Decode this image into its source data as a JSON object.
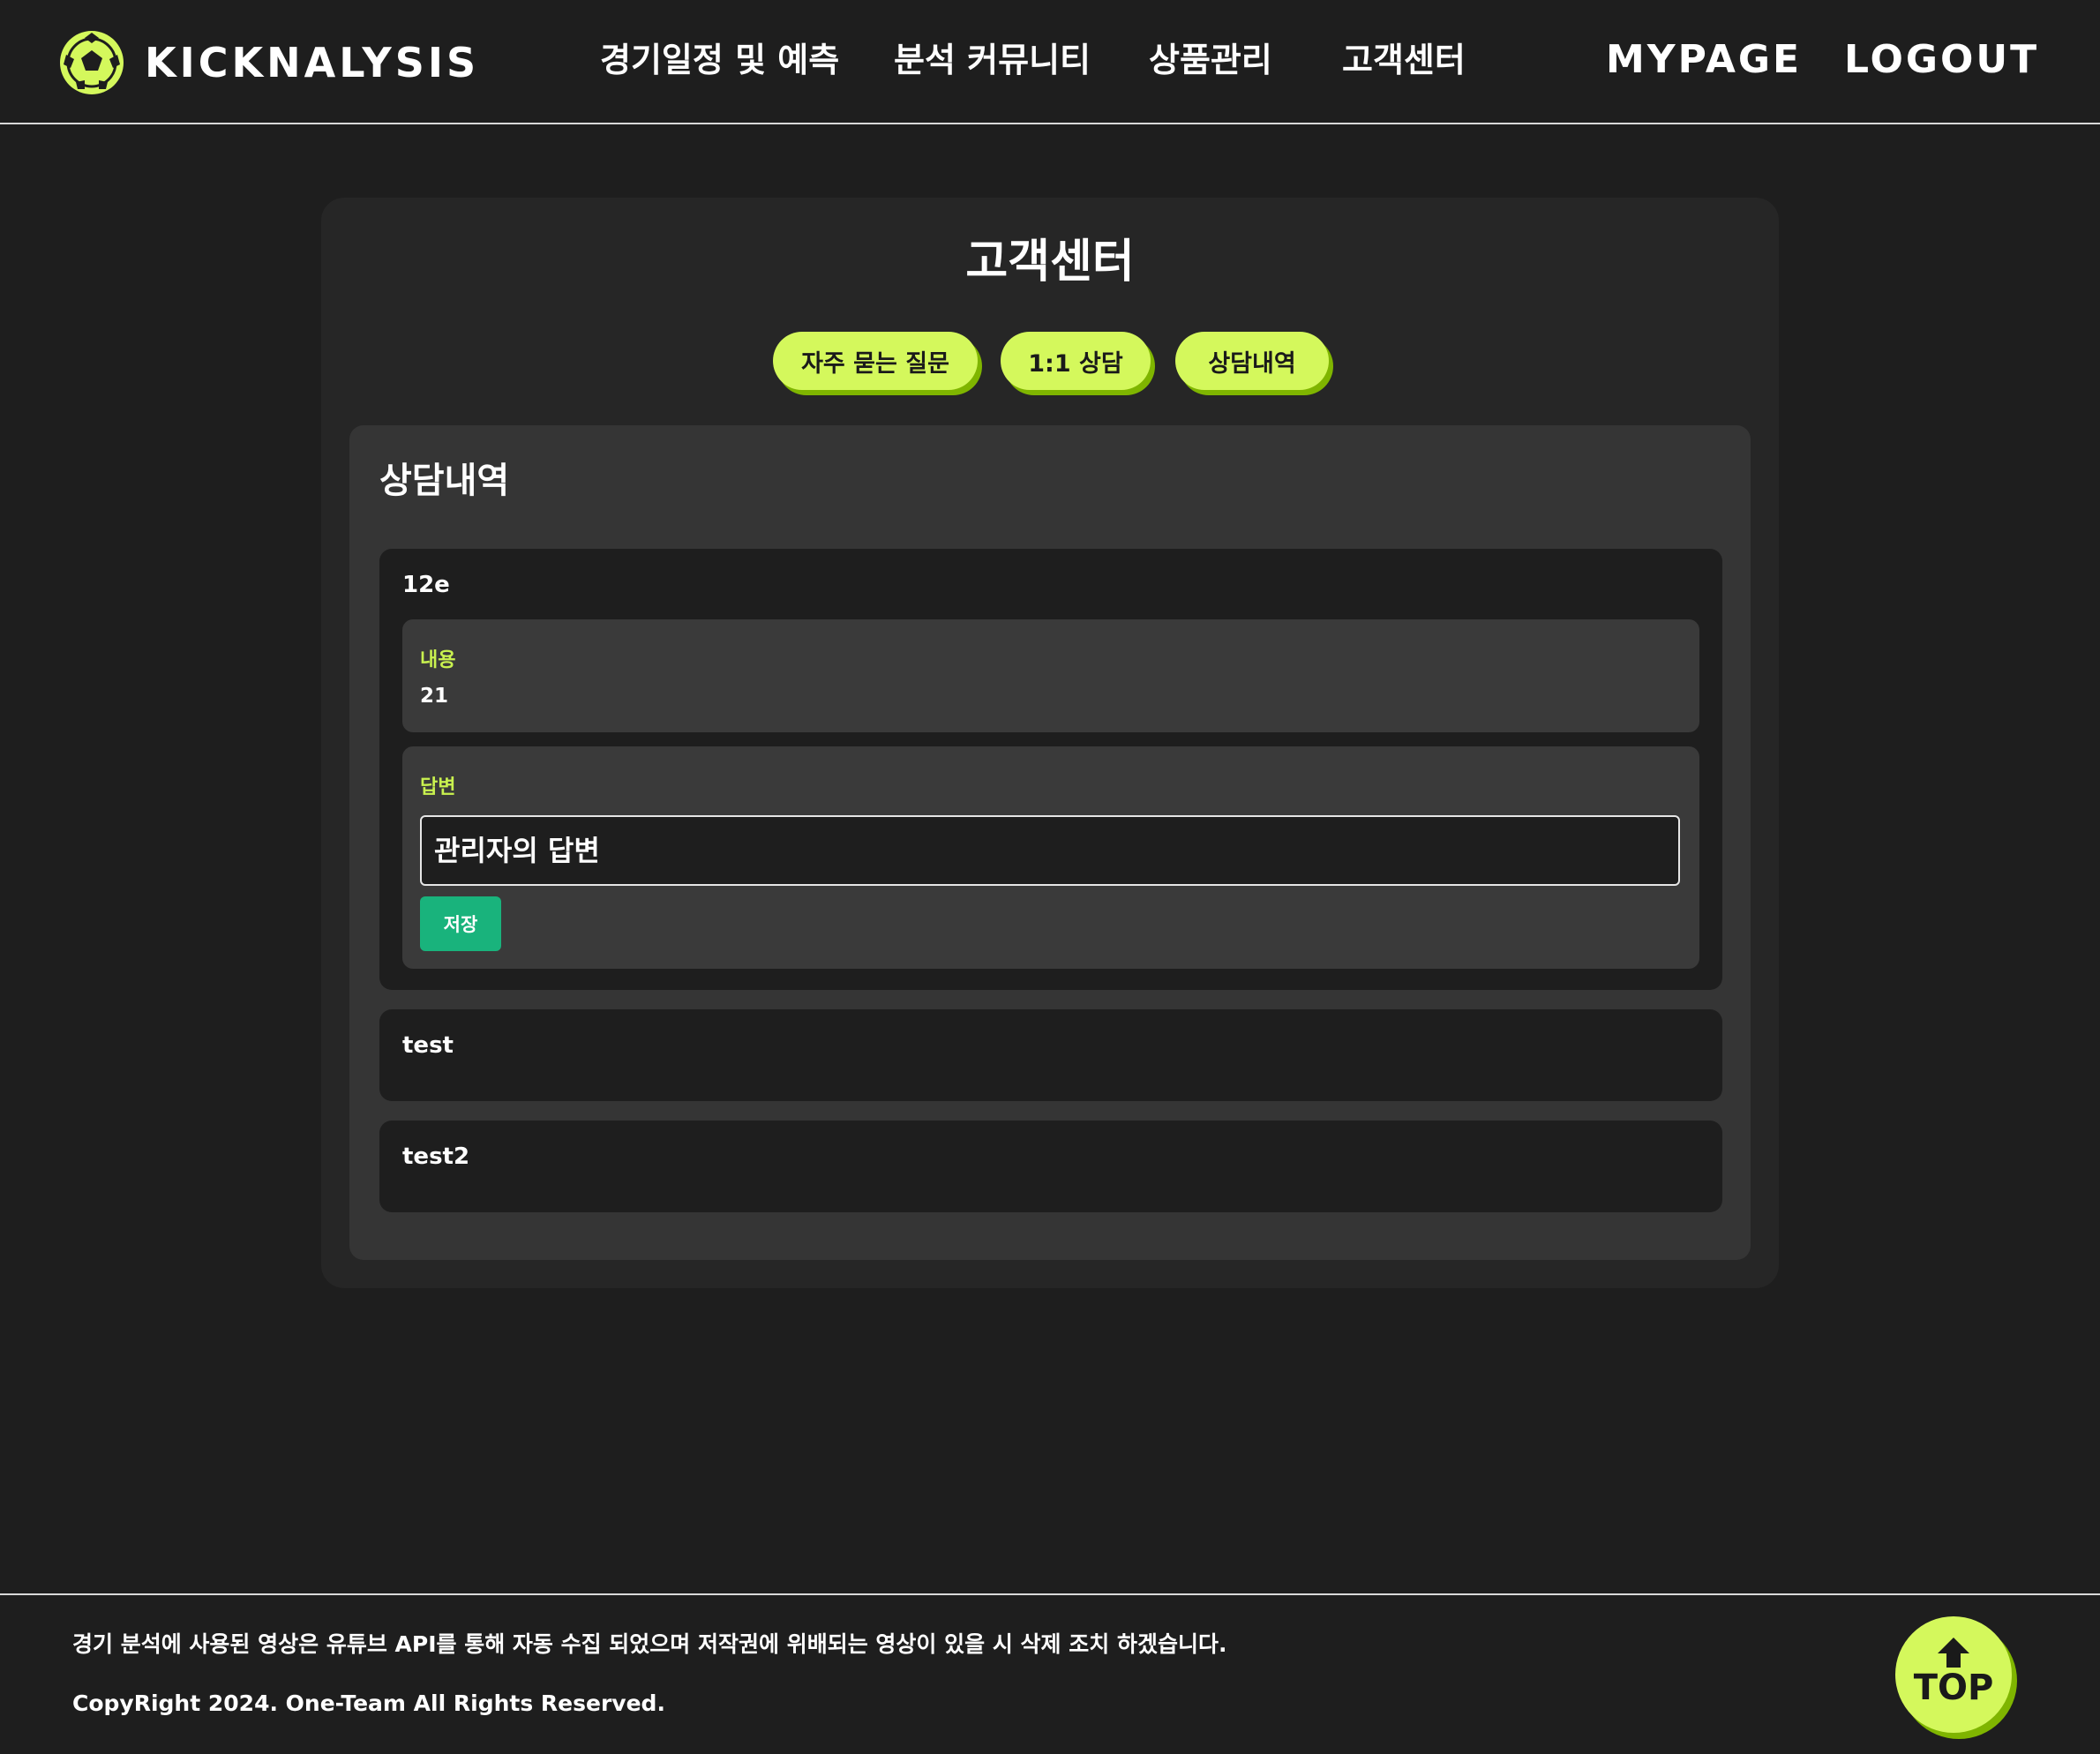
{
  "colors": {
    "background": "#1e1e1e",
    "accent": "#d4f85c",
    "accent_shadow": "#7fb500",
    "save_button": "#19b37c",
    "label": "#c9f24f"
  },
  "header": {
    "logo_icon": "soccer-ball-icon",
    "brand": "KICKNALYSIS",
    "nav": [
      {
        "label": "경기일정 및 예측"
      },
      {
        "label": "분석 커뮤니티"
      },
      {
        "label": "상품관리"
      },
      {
        "label": "고객센터"
      }
    ],
    "mypage": "MYPAGE",
    "logout": "LOGOUT"
  },
  "main": {
    "title": "고객센터",
    "tabs": [
      {
        "label": "자주 묻는 질문"
      },
      {
        "label": "1:1 상담"
      },
      {
        "label": "상담내역"
      }
    ],
    "panel_title": "상담내역",
    "inquiries": [
      {
        "title": "12e",
        "content_label": "내용",
        "content": "21",
        "answer_label": "답변",
        "answer_placeholder": "관리자의 답변",
        "save_label": "저장"
      },
      {
        "title": "test"
      },
      {
        "title": "test2"
      }
    ]
  },
  "footer": {
    "notice": "경기 분석에 사용된 영상은 유튜브 API를 통해 자동 수집 되었으며 저작권에 위배되는 영상이 있을 시 삭제 조치 하겠습니다.",
    "copyright": "CopyRight 2024. One-Team All Rights Reserved.",
    "top_button": "TOP",
    "top_icon": "arrow-up-icon"
  }
}
